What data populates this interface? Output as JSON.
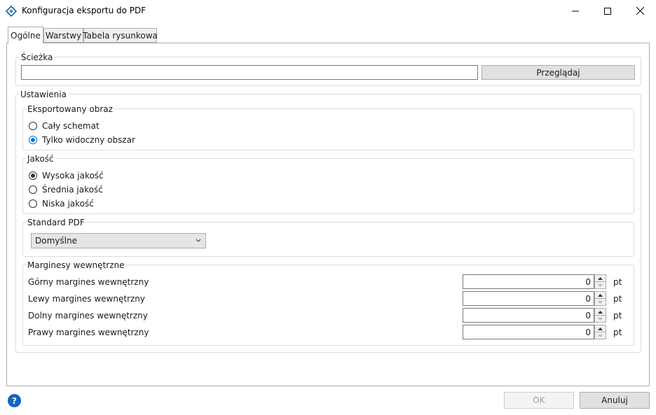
{
  "window": {
    "title": "Konfiguracja eksportu do PDF",
    "icons": {
      "app": "diamond-app-icon",
      "minimize": "minimize-icon",
      "maximize": "maximize-icon",
      "close": "close-icon"
    }
  },
  "tabs": [
    {
      "label": "Ogólne",
      "active": true
    },
    {
      "label": "Warstwy",
      "active": false
    },
    {
      "label": "Tabela rysunkowa",
      "active": false
    }
  ],
  "path_group": {
    "legend": "Ścieżka",
    "value": "",
    "browse_label": "Przeglądaj"
  },
  "settings": {
    "legend": "Ustawienia",
    "export_image": {
      "legend": "Eksportowany obraz",
      "options": [
        {
          "label": "Cały schemat",
          "selected": false
        },
        {
          "label": "Tylko widoczny obszar",
          "selected": true
        }
      ]
    },
    "quality": {
      "legend": "Jakość",
      "options": [
        {
          "label": "Wysoka jakość",
          "selected": true
        },
        {
          "label": "Średnia jakość",
          "selected": false
        },
        {
          "label": "Niska jakość",
          "selected": false
        }
      ]
    },
    "pdf_standard": {
      "legend": "Standard PDF",
      "selected": "Domyślne"
    },
    "margins": {
      "legend": "Marginesy wewnętrzne",
      "unit": "pt",
      "rows": [
        {
          "label": "Górny margines wewnętrzny",
          "value": "0"
        },
        {
          "label": "Lewy margines wewnętrzny",
          "value": "0"
        },
        {
          "label": "Dolny margines wewnętrzny",
          "value": "0"
        },
        {
          "label": "Prawy margines wewnętrzny",
          "value": "0"
        }
      ]
    }
  },
  "footer": {
    "help_icon": "help-icon",
    "help_glyph": "?",
    "ok_label": "OK",
    "cancel_label": "Anuluj"
  },
  "colors": {
    "accent": "#0078d7",
    "selected_radio_dark": "#333333",
    "help": "#1565c0"
  }
}
